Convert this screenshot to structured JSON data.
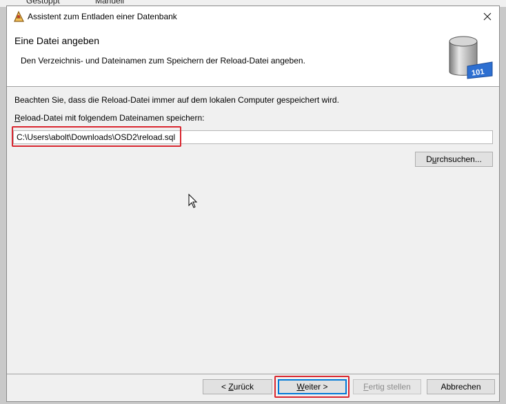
{
  "background_window": {
    "col1": "Gestoppt",
    "col2": "Manuell"
  },
  "window": {
    "title": "Assistent zum Entladen einer Datenbank",
    "icon": "wizard-app-icon",
    "close_icon": "close-icon"
  },
  "header": {
    "title": "Eine Datei angeben",
    "subtitle": "Den Verzeichnis- und Dateinamen zum Speichern der Reload-Datei angeben.",
    "icon": "database-icon",
    "icon_text": "101"
  },
  "body": {
    "note": "Beachten Sie, dass die Reload-Datei immer auf dem lokalen Computer gespeichert wird.",
    "field_label_access": "R",
    "field_label_rest": "eload-Datei mit folgendem Dateinamen speichern:",
    "path_value": "C:\\Users\\abolt\\Downloads\\OSD2\\reload.sql",
    "browse_pre": "D",
    "browse_access": "u",
    "browse_rest": "rchsuchen..."
  },
  "footer": {
    "back_pre": "< ",
    "back_access": "Z",
    "back_rest": "urück",
    "next_access": "W",
    "next_rest": "eiter >",
    "finish_access": "F",
    "finish_rest": "ertig stellen",
    "cancel_label": "Abbrechen"
  },
  "colors": {
    "highlight": "#d9262f",
    "focus": "#0078d7"
  }
}
